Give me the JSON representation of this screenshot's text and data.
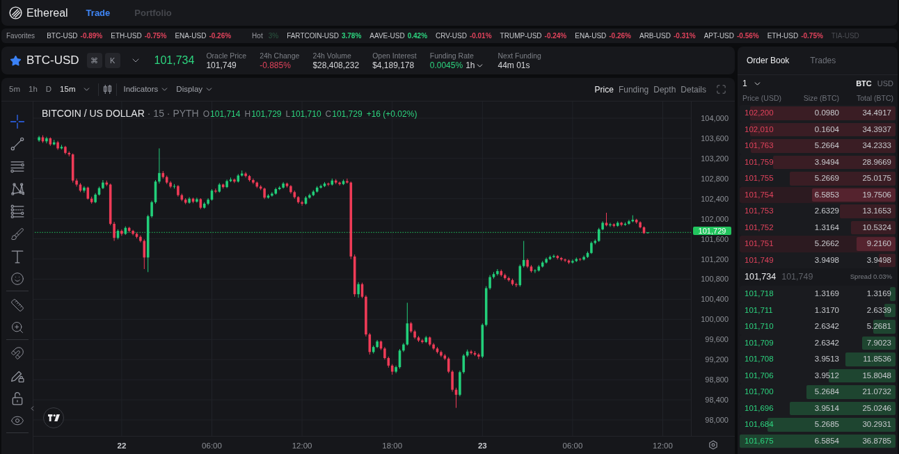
{
  "nav": {
    "brand": "Ethereal",
    "tabs": [
      {
        "label": "Trade",
        "selected": true
      },
      {
        "label": "Portfolio",
        "selected": false
      }
    ]
  },
  "ticker": {
    "groups": [
      {
        "label": "Favorites",
        "items": [
          {
            "symbol": "BTC-USD",
            "change": "-0.89%",
            "color": "#e2435c",
            "faded": false
          },
          {
            "symbol": "ETH-USD",
            "change": "-0.75%",
            "color": "#e2435c",
            "faded": false
          },
          {
            "symbol": "ENA-USD",
            "change": "-0.26%",
            "color": "#e2435c",
            "faded": false
          }
        ]
      },
      {
        "label": "Hot",
        "items": [
          {
            "change": "3%",
            "faded": true
          },
          {
            "symbol": "FARTCOIN-USD",
            "change": "3.78%",
            "color": "#2dd47f",
            "faded": false
          },
          {
            "symbol": "AAVE-USD",
            "change": "0.42%",
            "color": "#2dd47f",
            "faded": false
          },
          {
            "symbol": "CRV-USD",
            "change": "-0.01%",
            "color": "#e2435c",
            "faded": false
          },
          {
            "symbol": "TRUMP-USD",
            "change": "-0.24%",
            "color": "#e2435c",
            "faded": false
          },
          {
            "symbol": "ENA-USD",
            "change": "-0.26%",
            "color": "#e2435c",
            "faded": false
          },
          {
            "symbol": "ARB-USD",
            "change": "-0.31%",
            "color": "#e2435c",
            "faded": false
          },
          {
            "symbol": "APT-USD",
            "change": "-0.56%",
            "color": "#e2435c",
            "faded": false
          },
          {
            "symbol": "ETH-USD",
            "change": "-0.75%",
            "color": "#e2435c",
            "faded": false
          },
          {
            "symbol": "TIA-USD",
            "faded": true
          }
        ]
      }
    ]
  },
  "market": {
    "symbol": "BTC-USD",
    "favorite": true,
    "shortcut_keys": [
      "⌘",
      "K"
    ],
    "price": "101,734",
    "stats": [
      {
        "label": "Oracle Price",
        "value": "101,749",
        "color": "#d6d7da"
      },
      {
        "label": "24h Change",
        "value": "-0.885%",
        "color": "#e2435c"
      },
      {
        "label": "24h Volume",
        "value": "$28,408,232",
        "color": "#d6d7da"
      },
      {
        "label": "Open Interest",
        "value": "$4,189,178",
        "color": "#d6d7da"
      },
      {
        "label": "Funding Rate",
        "value": "0.0045%",
        "color": "#2dd47f",
        "interval": "1h"
      },
      {
        "label": "Next Funding",
        "value": "44m 01s",
        "color": "#d6d7da"
      }
    ]
  },
  "chart": {
    "intervals": [
      "5m",
      "1h",
      "D"
    ],
    "interval_select": "15m",
    "menus": [
      "Indicators",
      "Display"
    ],
    "views": [
      {
        "label": "Price",
        "selected": true
      },
      {
        "label": "Funding",
        "selected": false
      },
      {
        "label": "Depth",
        "selected": false
      },
      {
        "label": "Details",
        "selected": false
      }
    ],
    "tool_groups": [
      {
        "tools": [
          {
            "kind": "crosshair",
            "selected": true
          },
          {
            "kind": "trend_line",
            "selected": false
          },
          {
            "kind": "horizontal_lines",
            "selected": false
          },
          {
            "kind": "pattern",
            "selected": false
          },
          {
            "kind": "fib",
            "selected": false
          },
          {
            "kind": "brush",
            "selected": false
          },
          {
            "kind": "text",
            "selected": false
          },
          {
            "kind": "emoji",
            "selected": false
          }
        ]
      },
      {
        "tools": [
          {
            "kind": "ruler",
            "selected": false
          },
          {
            "kind": "zoom",
            "selected": false
          }
        ]
      },
      {
        "tools": [
          {
            "kind": "magnet",
            "selected": false
          },
          {
            "kind": "drawing_lock",
            "selected": false
          },
          {
            "kind": "lock",
            "selected": false
          },
          {
            "kind": "visibility",
            "selected": false
          }
        ]
      }
    ],
    "legend": {
      "title": "BITCOIN / US DOLLAR",
      "meta": "· 15 · PYTH",
      "ohlc": [
        {
          "key": "O",
          "value": "101,714"
        },
        {
          "key": "H",
          "value": "101,729"
        },
        {
          "key": "L",
          "value": "101,710"
        },
        {
          "key": "C",
          "value": "101,729"
        }
      ],
      "change": "+16 (+0.02%)"
    },
    "bold_time_labels": [
      true,
      false,
      false,
      false,
      true,
      false,
      false
    ],
    "chart_data": {
      "type": "candlestick",
      "grid": true,
      "ylim": [
        97682,
        104332
      ],
      "ref_lines": [
        {
          "axis": "y",
          "value": 101729,
          "label": "101,729",
          "color": "#22c55e"
        }
      ],
      "categories": [
        null,
        null,
        null,
        null,
        null,
        null,
        null,
        null,
        null,
        null,
        null,
        null,
        null,
        null,
        null,
        null,
        null,
        null,
        null,
        null,
        null,
        null,
        null,
        "22",
        null,
        null,
        null,
        null,
        null,
        null,
        null,
        null,
        null,
        null,
        null,
        null,
        null,
        null,
        null,
        null,
        null,
        null,
        null,
        null,
        null,
        null,
        null,
        "06:00",
        null,
        null,
        null,
        null,
        null,
        null,
        null,
        null,
        null,
        null,
        null,
        null,
        null,
        null,
        null,
        null,
        null,
        null,
        null,
        null,
        null,
        null,
        null,
        "12:00",
        null,
        null,
        null,
        null,
        null,
        null,
        null,
        null,
        null,
        null,
        null,
        null,
        null,
        null,
        null,
        null,
        null,
        null,
        null,
        null,
        null,
        null,
        null,
        "18:00",
        null,
        null,
        null,
        null,
        null,
        null,
        null,
        null,
        null,
        null,
        null,
        null,
        null,
        null,
        null,
        null,
        null,
        null,
        null,
        null,
        null,
        null,
        null,
        "23",
        null,
        null,
        null,
        null,
        null,
        null,
        null,
        null,
        null,
        null,
        null,
        null,
        null,
        null,
        null,
        null,
        null,
        null,
        null,
        null,
        null,
        null,
        null,
        "06:00",
        null,
        null,
        null,
        null,
        null,
        null,
        null,
        null,
        null,
        null,
        null,
        null,
        null,
        null,
        null,
        null,
        null,
        null,
        null,
        null,
        null,
        null,
        null,
        "12:00",
        null,
        null,
        null,
        null,
        null,
        null,
        null
      ],
      "yticks": [
        {
          "value": 104000,
          "label": "104,000"
        },
        {
          "value": 103600,
          "label": "103,600"
        },
        {
          "value": 103200,
          "label": "103,200"
        },
        {
          "value": 102800,
          "label": "102,800"
        },
        {
          "value": 102400,
          "label": "102,400"
        },
        {
          "value": 102000,
          "label": "102,000"
        },
        {
          "value": 101600,
          "label": "101,600"
        },
        {
          "value": 101200,
          "label": "101,200"
        },
        {
          "value": 100800,
          "label": "100,800"
        },
        {
          "value": 100400,
          "label": "100,400"
        },
        {
          "value": 100000,
          "label": "100,000"
        },
        {
          "value": 99600,
          "label": "99,600"
        },
        {
          "value": 99200,
          "label": "99,200"
        },
        {
          "value": 98800,
          "label": "98,800"
        },
        {
          "value": 98400,
          "label": "98,400"
        },
        {
          "value": 98000,
          "label": "98,000"
        }
      ],
      "ohlc": [
        null,
        [
          103560,
          103650,
          103530,
          103620
        ],
        [
          103620,
          103660,
          103510,
          103540
        ],
        [
          103540,
          103630,
          103500,
          103600
        ],
        [
          103600,
          103620,
          103450,
          103480
        ],
        [
          103480,
          103570,
          103460,
          103520
        ],
        [
          103520,
          103550,
          103370,
          103400
        ],
        [
          103400,
          103470,
          103380,
          103430
        ],
        [
          103430,
          103450,
          103280,
          103310
        ],
        [
          103310,
          103340,
          103240,
          103280
        ],
        [
          103280,
          103300,
          102720,
          102760
        ],
        [
          102760,
          102800,
          102640,
          102680
        ],
        [
          102680,
          102710,
          102530,
          102560
        ],
        [
          102560,
          102650,
          102520,
          102620
        ],
        [
          102620,
          102640,
          102380,
          102400
        ],
        [
          102400,
          102440,
          102300,
          102330
        ],
        [
          102330,
          102510,
          102310,
          102480
        ],
        [
          102480,
          102640,
          102460,
          102610
        ],
        [
          102610,
          102770,
          102590,
          102720
        ],
        [
          102720,
          102760,
          102650,
          102680
        ],
        [
          102680,
          102700,
          101870,
          101900
        ],
        [
          101900,
          101940,
          101560,
          101620
        ],
        [
          101620,
          101790,
          101590,
          101760
        ],
        [
          101760,
          101790,
          101660,
          101700
        ],
        [
          101700,
          101850,
          101680,
          101820
        ],
        [
          101820,
          101840,
          101730,
          101760
        ],
        [
          101760,
          101780,
          101670,
          101700
        ],
        [
          101700,
          101730,
          101610,
          101640
        ],
        [
          101640,
          101670,
          101530,
          101560
        ],
        [
          101560,
          101590,
          101000,
          101230
        ],
        [
          101230,
          102080,
          100940,
          102050
        ],
        [
          102050,
          102360,
          102020,
          102330
        ],
        [
          102330,
          102770,
          102300,
          102740
        ],
        [
          102740,
          103400,
          102700,
          102910
        ],
        [
          102910,
          102950,
          102800,
          102830
        ],
        [
          102830,
          102860,
          102690,
          102720
        ],
        [
          102720,
          102750,
          102610,
          102640
        ],
        [
          102640,
          102690,
          102600,
          102650
        ],
        [
          102650,
          102670,
          102440,
          102470
        ],
        [
          102470,
          102500,
          102350,
          102380
        ],
        [
          102380,
          102410,
          102290,
          102320
        ],
        [
          102320,
          102430,
          102300,
          102400
        ],
        [
          102400,
          102420,
          102310,
          102340
        ],
        [
          102340,
          102420,
          102320,
          102390
        ],
        [
          102390,
          102410,
          102190,
          102220
        ],
        [
          102220,
          102330,
          102200,
          102300
        ],
        [
          102300,
          102410,
          102270,
          102380
        ],
        [
          102380,
          102590,
          102360,
          102560
        ],
        [
          102560,
          102600,
          102510,
          102540
        ],
        [
          102540,
          102710,
          102520,
          102680
        ],
        [
          102680,
          102700,
          102600,
          102630
        ],
        [
          102630,
          102780,
          102610,
          102750
        ],
        [
          102750,
          102820,
          102730,
          102780
        ],
        [
          102780,
          102800,
          102710,
          102740
        ],
        [
          102740,
          102890,
          102720,
          102860
        ],
        [
          102860,
          102960,
          102840,
          102900
        ],
        [
          102900,
          102930,
          102820,
          102850
        ],
        [
          102850,
          102870,
          102740,
          102770
        ],
        [
          102770,
          102800,
          102690,
          102720
        ],
        [
          102720,
          102740,
          102610,
          102640
        ],
        [
          102640,
          102670,
          102570,
          102600
        ],
        [
          102600,
          102620,
          102390,
          102420
        ],
        [
          102420,
          102490,
          102400,
          102460
        ],
        [
          102460,
          102530,
          102440,
          102500
        ],
        [
          102500,
          102620,
          102480,
          102590
        ],
        [
          102590,
          102650,
          102570,
          102620
        ],
        [
          102620,
          102730,
          102600,
          102700
        ],
        [
          102700,
          102720,
          102620,
          102650
        ],
        [
          102650,
          102670,
          102500,
          102530
        ],
        [
          102530,
          102560,
          102400,
          102430
        ],
        [
          102430,
          102450,
          102300,
          102330
        ],
        [
          102330,
          102360,
          102260,
          102300
        ],
        [
          102300,
          102450,
          102280,
          102420
        ],
        [
          102420,
          102500,
          102400,
          102470
        ],
        [
          102470,
          102570,
          102450,
          102540
        ],
        [
          102540,
          102650,
          102520,
          102620
        ],
        [
          102620,
          102680,
          102600,
          102650
        ],
        [
          102650,
          102730,
          102630,
          102700
        ],
        [
          102700,
          102720,
          102650,
          102680
        ],
        [
          102680,
          102800,
          102660,
          102760
        ],
        [
          102760,
          102790,
          102690,
          102720
        ],
        [
          102720,
          102740,
          102660,
          102690
        ],
        [
          102690,
          102780,
          102670,
          102750
        ],
        [
          102750,
          102800,
          102700,
          102720
        ],
        [
          102720,
          102740,
          101200,
          101250
        ],
        [
          101250,
          101290,
          100450,
          100500
        ],
        [
          100500,
          100740,
          100430,
          100700
        ],
        [
          100700,
          100730,
          100420,
          100450
        ],
        [
          100450,
          100480,
          99660,
          99700
        ],
        [
          99700,
          99730,
          99300,
          99350
        ],
        [
          99350,
          99480,
          99320,
          99450
        ],
        [
          99450,
          99590,
          99430,
          99560
        ],
        [
          99560,
          99580,
          99390,
          99420
        ],
        [
          99420,
          99450,
          99200,
          99230
        ],
        [
          99230,
          99260,
          99040,
          99080
        ],
        [
          99080,
          99110,
          98900,
          98960
        ],
        [
          98960,
          99080,
          98930,
          99050
        ],
        [
          99050,
          99410,
          99020,
          99380
        ],
        [
          99380,
          99530,
          99350,
          99500
        ],
        [
          99500,
          100330,
          99480,
          99920
        ],
        [
          99920,
          99950,
          99730,
          99760
        ],
        [
          99760,
          99790,
          99610,
          99640
        ],
        [
          99640,
          99670,
          99550,
          99580
        ],
        [
          99580,
          99610,
          99520,
          99550
        ],
        [
          99550,
          99670,
          99530,
          99640
        ],
        [
          99640,
          99660,
          99470,
          99500
        ],
        [
          99500,
          99530,
          99390,
          99420
        ],
        [
          99420,
          99450,
          99320,
          99350
        ],
        [
          99350,
          99380,
          99250,
          99280
        ],
        [
          99280,
          99310,
          99190,
          99220
        ],
        [
          99220,
          99250,
          98930,
          98960
        ],
        [
          98960,
          98990,
          98560,
          98600
        ],
        [
          98600,
          98640,
          98240,
          98500
        ],
        [
          98500,
          98980,
          98470,
          98950
        ],
        [
          98950,
          99310,
          98920,
          99280
        ],
        [
          99280,
          99400,
          99250,
          99360
        ],
        [
          99360,
          99390,
          99300,
          99330
        ],
        [
          99330,
          99370,
          99270,
          99300
        ],
        [
          99300,
          99330,
          99210,
          99260
        ],
        [
          99260,
          99920,
          99230,
          99890
        ],
        [
          99890,
          100660,
          99860,
          100620
        ],
        [
          100620,
          100880,
          100590,
          100840
        ],
        [
          100840,
          100940,
          100810,
          100900
        ],
        [
          100900,
          101000,
          100870,
          100960
        ],
        [
          100960,
          100990,
          100850,
          100880
        ],
        [
          100880,
          100910,
          100790,
          100820
        ],
        [
          100820,
          100850,
          100750,
          100780
        ],
        [
          100780,
          100810,
          100670,
          100700
        ],
        [
          100700,
          100730,
          100640,
          100680
        ],
        [
          100680,
          101090,
          100650,
          101060
        ],
        [
          101060,
          101560,
          101030,
          101180
        ],
        [
          101180,
          101210,
          101020,
          101050
        ],
        [
          101050,
          101080,
          100930,
          100960
        ],
        [
          100960,
          101000,
          100920,
          100970
        ],
        [
          100970,
          101080,
          100950,
          101050
        ],
        [
          101050,
          101160,
          101030,
          101130
        ],
        [
          101130,
          101230,
          101110,
          101200
        ],
        [
          101200,
          101270,
          101180,
          101240
        ],
        [
          101240,
          101290,
          101220,
          101260
        ],
        [
          101260,
          101280,
          101190,
          101220
        ],
        [
          101220,
          101240,
          101160,
          101190
        ],
        [
          101190,
          101210,
          101140,
          101170
        ],
        [
          101170,
          101190,
          101100,
          101130
        ],
        [
          101130,
          101190,
          101110,
          101160
        ],
        [
          101160,
          101230,
          101140,
          101200
        ],
        [
          101200,
          101220,
          101160,
          101190
        ],
        [
          101190,
          101270,
          101170,
          101240
        ],
        [
          101240,
          101350,
          101220,
          101320
        ],
        [
          101320,
          101550,
          101300,
          101520
        ],
        [
          101520,
          101590,
          101490,
          101560
        ],
        [
          101560,
          101820,
          101540,
          101790
        ],
        [
          101790,
          101950,
          101770,
          101920
        ],
        [
          101920,
          102120,
          101850,
          101870
        ],
        [
          101870,
          101920,
          101840,
          101890
        ],
        [
          101890,
          101910,
          101830,
          101860
        ],
        [
          101860,
          101950,
          101840,
          101920
        ],
        [
          101920,
          101940,
          101850,
          101880
        ],
        [
          101880,
          101930,
          101860,
          101900
        ],
        [
          101900,
          101980,
          101880,
          101950
        ],
        [
          101950,
          102070,
          101930,
          101980
        ],
        [
          101980,
          102000,
          101900,
          101930
        ],
        [
          101930,
          101950,
          101810,
          101830
        ],
        [
          101830,
          101850,
          101700,
          101714
        ],
        [
          101714,
          101729,
          101710,
          101729
        ],
        null,
        null,
        null,
        null,
        null,
        null,
        null,
        null,
        null,
        null,
        null
      ]
    }
  },
  "order_book": {
    "tabs": [
      {
        "label": "Order Book",
        "selected": true
      },
      {
        "label": "Trades",
        "selected": false
      }
    ],
    "grouping": "1",
    "units": [
      {
        "label": "BTC",
        "selected": true
      },
      {
        "label": "USD",
        "selected": false
      }
    ],
    "columns": [
      "Price (USD)",
      "Size (BTC)",
      "Total (BTC)"
    ],
    "asks": [
      {
        "price": "102,200",
        "size": "0.0980",
        "total": "34.4917",
        "level": 0.935,
        "highlighted": false
      },
      {
        "price": "102,010",
        "size": "0.1604",
        "total": "34.3937",
        "level": 0.933,
        "highlighted": false
      },
      {
        "price": "101,763",
        "size": "5.2664",
        "total": "34.2333",
        "level": 0.928,
        "highlighted": false
      },
      {
        "price": "101,759",
        "size": "3.9494",
        "total": "28.9669",
        "level": 0.785,
        "highlighted": false
      },
      {
        "price": "101,755",
        "size": "5.2669",
        "total": "25.0175",
        "level": 0.678,
        "highlighted": false
      },
      {
        "price": "101,754",
        "size": "6.5853",
        "total": "19.7506",
        "level": 0.536,
        "highlighted": true
      },
      {
        "price": "101,753",
        "size": "2.6329",
        "total": "13.1653",
        "level": 0.357,
        "highlighted": false
      },
      {
        "price": "101,752",
        "size": "1.3164",
        "total": "10.5324",
        "level": 0.286,
        "highlighted": false
      },
      {
        "price": "101,751",
        "size": "5.2662",
        "total": "9.2160",
        "level": 0.25,
        "highlighted": true
      },
      {
        "price": "101,749",
        "size": "3.9498",
        "total": "3.9498",
        "level": 0.107,
        "highlighted": false
      }
    ],
    "mid": {
      "price": "101,734",
      "oracle": "101,749",
      "spread": "Spread 0.03%"
    },
    "bids": [
      {
        "price": "101,718",
        "size": "1.3169",
        "total": "1.3169",
        "level": 0.036,
        "highlighted": false
      },
      {
        "price": "101,711",
        "size": "1.3170",
        "total": "2.6339",
        "level": 0.071,
        "highlighted": false
      },
      {
        "price": "101,710",
        "size": "2.6342",
        "total": "5.2681",
        "level": 0.143,
        "highlighted": false
      },
      {
        "price": "101,709",
        "size": "2.6342",
        "total": "7.9023",
        "level": 0.214,
        "highlighted": false
      },
      {
        "price": "101,708",
        "size": "3.9513",
        "total": "11.8536",
        "level": 0.321,
        "highlighted": false
      },
      {
        "price": "101,706",
        "size": "3.9512",
        "total": "15.8048",
        "level": 0.429,
        "highlighted": false
      },
      {
        "price": "101,700",
        "size": "5.2684",
        "total": "21.0732",
        "level": 0.571,
        "highlighted": false
      },
      {
        "price": "101,696",
        "size": "3.9514",
        "total": "25.0246",
        "level": 0.679,
        "highlighted": false
      },
      {
        "price": "101,684",
        "size": "5.2685",
        "total": "30.2931",
        "level": 0.821,
        "highlighted": false
      },
      {
        "price": "101,675",
        "size": "6.5854",
        "total": "36.8785",
        "level": 1.0,
        "highlighted": false
      }
    ]
  }
}
